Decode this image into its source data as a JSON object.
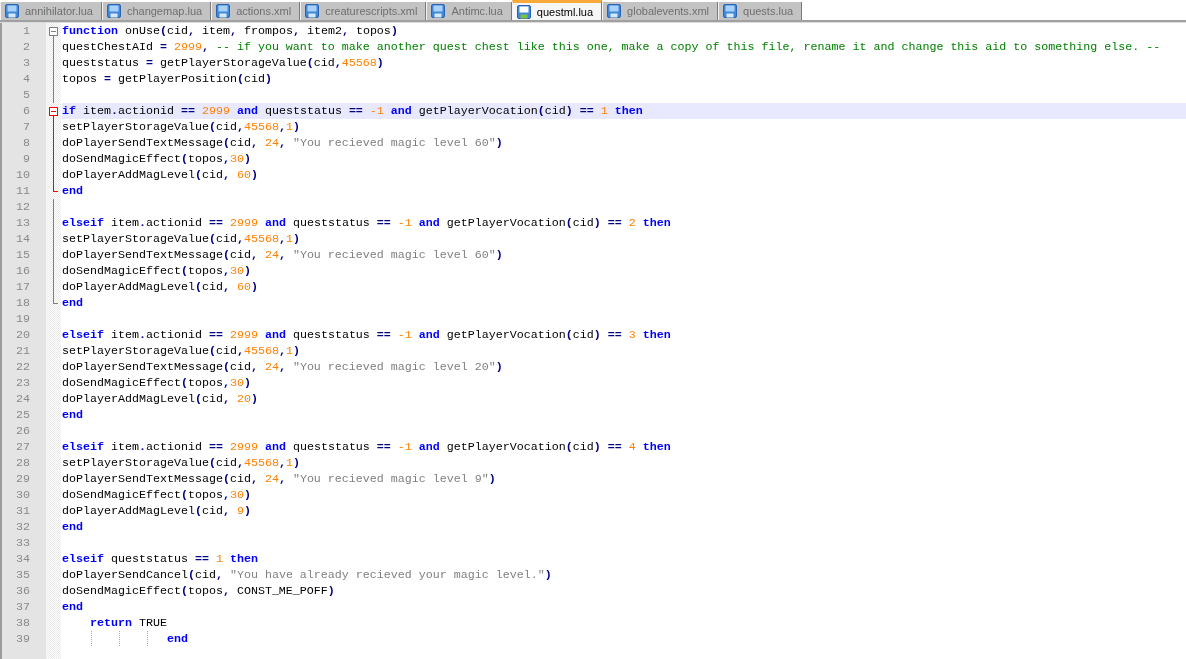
{
  "tabs": [
    {
      "label": "annihilator.lua",
      "selected": false
    },
    {
      "label": "changemap.lua",
      "selected": false
    },
    {
      "label": "actions.xml",
      "selected": false
    },
    {
      "label": "creaturescripts.xml",
      "selected": false
    },
    {
      "label": "Antimc.lua",
      "selected": false
    },
    {
      "label": "questml.lua",
      "selected": true
    },
    {
      "label": "globalevents.xml",
      "selected": false
    },
    {
      "label": "quests.lua",
      "selected": false
    }
  ],
  "editor": {
    "lines": [
      {
        "number": "1",
        "current": false,
        "fold": {
          "kind": "head",
          "highlighted": false
        },
        "tokens": [
          {
            "kind": "keyword",
            "text": "function"
          },
          {
            "kind": "identifier",
            "text": " onUse"
          },
          {
            "kind": "operator",
            "text": "("
          },
          {
            "kind": "identifier",
            "text": "cid"
          },
          {
            "kind": "operator",
            "text": ","
          },
          {
            "kind": "identifier",
            "text": " item"
          },
          {
            "kind": "operator",
            "text": ","
          },
          {
            "kind": "identifier",
            "text": " frompos"
          },
          {
            "kind": "operator",
            "text": ","
          },
          {
            "kind": "identifier",
            "text": " item2"
          },
          {
            "kind": "operator",
            "text": ","
          },
          {
            "kind": "identifier",
            "text": " topos"
          },
          {
            "kind": "operator",
            "text": ")"
          }
        ]
      },
      {
        "number": "2",
        "current": false,
        "fold": {
          "kind": "body",
          "highlighted": false
        },
        "tokens": [
          {
            "kind": "identifier",
            "text": "questChestAId "
          },
          {
            "kind": "operator",
            "text": "="
          },
          {
            "kind": "number",
            "text": " 2999"
          },
          {
            "kind": "operator",
            "text": ","
          },
          {
            "kind": "comment",
            "text": " -- if you want to make another quest chest like this one, make a copy of this file, rename it and change this aid to something else. --"
          }
        ]
      },
      {
        "number": "3",
        "current": false,
        "fold": {
          "kind": "body",
          "highlighted": false
        },
        "tokens": [
          {
            "kind": "identifier",
            "text": "queststatus "
          },
          {
            "kind": "operator",
            "text": "="
          },
          {
            "kind": "identifier",
            "text": " getPlayerStorageValue"
          },
          {
            "kind": "operator",
            "text": "("
          },
          {
            "kind": "identifier",
            "text": "cid"
          },
          {
            "kind": "operator",
            "text": ","
          },
          {
            "kind": "number",
            "text": "45568"
          },
          {
            "kind": "operator",
            "text": ")"
          }
        ]
      },
      {
        "number": "4",
        "current": false,
        "fold": {
          "kind": "body",
          "highlighted": false
        },
        "tokens": [
          {
            "kind": "identifier",
            "text": "topos "
          },
          {
            "kind": "operator",
            "text": "="
          },
          {
            "kind": "identifier",
            "text": " getPlayerPosition"
          },
          {
            "kind": "operator",
            "text": "("
          },
          {
            "kind": "identifier",
            "text": "cid"
          },
          {
            "kind": "operator",
            "text": ")"
          }
        ]
      },
      {
        "number": "5",
        "current": false,
        "fold": {
          "kind": "body",
          "highlighted": false
        }
      },
      {
        "number": "6",
        "current": true,
        "fold": {
          "kind": "head",
          "highlighted": true
        },
        "tokens": [
          {
            "kind": "keyword",
            "text": "if"
          },
          {
            "kind": "identifier",
            "text": " item"
          },
          {
            "kind": "operator",
            "text": "."
          },
          {
            "kind": "identifier",
            "text": "actionid "
          },
          {
            "kind": "operator",
            "text": "=="
          },
          {
            "kind": "number",
            "text": " 2999 "
          },
          {
            "kind": "keyword",
            "text": "and"
          },
          {
            "kind": "identifier",
            "text": " queststatus "
          },
          {
            "kind": "operator",
            "text": "=="
          },
          {
            "kind": "number",
            "text": " -1 "
          },
          {
            "kind": "keyword",
            "text": "and"
          },
          {
            "kind": "identifier",
            "text": " getPlayerVocation"
          },
          {
            "kind": "operator",
            "text": "("
          },
          {
            "kind": "identifier",
            "text": "cid"
          },
          {
            "kind": "operator",
            "text": ")"
          },
          {
            "kind": "operator",
            "text": " == "
          },
          {
            "kind": "number",
            "text": "1 "
          },
          {
            "kind": "keyword",
            "text": "then"
          }
        ]
      },
      {
        "number": "7",
        "current": false,
        "fold": {
          "kind": "body",
          "highlighted": true
        },
        "tokens": [
          {
            "kind": "identifier",
            "text": "setPlayerStorageValue"
          },
          {
            "kind": "operator",
            "text": "("
          },
          {
            "kind": "identifier",
            "text": "cid"
          },
          {
            "kind": "operator",
            "text": ","
          },
          {
            "kind": "number",
            "text": "45568"
          },
          {
            "kind": "operator",
            "text": ","
          },
          {
            "kind": "number",
            "text": "1"
          },
          {
            "kind": "operator",
            "text": ")"
          }
        ]
      },
      {
        "number": "8",
        "current": false,
        "fold": {
          "kind": "body",
          "highlighted": true
        },
        "tokens": [
          {
            "kind": "identifier",
            "text": "doPlayerSendTextMessage"
          },
          {
            "kind": "operator",
            "text": "("
          },
          {
            "kind": "identifier",
            "text": "cid"
          },
          {
            "kind": "operator",
            "text": ","
          },
          {
            "kind": "number",
            "text": " 24"
          },
          {
            "kind": "operator",
            "text": ","
          },
          {
            "kind": "string",
            "text": " \"You recieved magic level 60\""
          },
          {
            "kind": "operator",
            "text": ")"
          }
        ]
      },
      {
        "number": "9",
        "current": false,
        "fold": {
          "kind": "body",
          "highlighted": true
        },
        "tokens": [
          {
            "kind": "identifier",
            "text": "doSendMagicEffect"
          },
          {
            "kind": "operator",
            "text": "("
          },
          {
            "kind": "identifier",
            "text": "topos"
          },
          {
            "kind": "operator",
            "text": ","
          },
          {
            "kind": "number",
            "text": "30"
          },
          {
            "kind": "operator",
            "text": ")"
          }
        ]
      },
      {
        "number": "10",
        "current": false,
        "fold": {
          "kind": "body",
          "highlighted": true
        },
        "tokens": [
          {
            "kind": "identifier",
            "text": "doPlayerAddMagLevel"
          },
          {
            "kind": "operator",
            "text": "("
          },
          {
            "kind": "identifier",
            "text": "cid"
          },
          {
            "kind": "operator",
            "text": ","
          },
          {
            "kind": "number",
            "text": " 60"
          },
          {
            "kind": "operator",
            "text": ")"
          }
        ]
      },
      {
        "number": "11",
        "current": false,
        "fold": {
          "kind": "tail",
          "highlighted": true
        },
        "tokens": [
          {
            "kind": "keyword",
            "text": "end"
          }
        ]
      },
      {
        "number": "12",
        "current": false,
        "fold": {
          "kind": "body",
          "highlighted": false
        }
      },
      {
        "number": "13",
        "current": false,
        "fold": {
          "kind": "body",
          "highlighted": false
        },
        "tokens": [
          {
            "kind": "keyword",
            "text": "elseif"
          },
          {
            "kind": "identifier",
            "text": " item"
          },
          {
            "kind": "operator",
            "text": "."
          },
          {
            "kind": "identifier",
            "text": "actionid "
          },
          {
            "kind": "operator",
            "text": "=="
          },
          {
            "kind": "number",
            "text": " 2999 "
          },
          {
            "kind": "keyword",
            "text": "and"
          },
          {
            "kind": "identifier",
            "text": " queststatus "
          },
          {
            "kind": "operator",
            "text": "=="
          },
          {
            "kind": "number",
            "text": " -1 "
          },
          {
            "kind": "keyword",
            "text": "and"
          },
          {
            "kind": "identifier",
            "text": " getPlayerVocation"
          },
          {
            "kind": "operator",
            "text": "("
          },
          {
            "kind": "identifier",
            "text": "cid"
          },
          {
            "kind": "operator",
            "text": ")"
          },
          {
            "kind": "operator",
            "text": " == "
          },
          {
            "kind": "number",
            "text": "2 "
          },
          {
            "kind": "keyword",
            "text": "then"
          }
        ]
      },
      {
        "number": "14",
        "current": false,
        "fold": {
          "kind": "body",
          "highlighted": false
        },
        "tokens": [
          {
            "kind": "identifier",
            "text": "setPlayerStorageValue"
          },
          {
            "kind": "operator",
            "text": "("
          },
          {
            "kind": "identifier",
            "text": "cid"
          },
          {
            "kind": "operator",
            "text": ","
          },
          {
            "kind": "number",
            "text": "45568"
          },
          {
            "kind": "operator",
            "text": ","
          },
          {
            "kind": "number",
            "text": "1"
          },
          {
            "kind": "operator",
            "text": ")"
          }
        ]
      },
      {
        "number": "15",
        "current": false,
        "fold": {
          "kind": "body",
          "highlighted": false
        },
        "tokens": [
          {
            "kind": "identifier",
            "text": "doPlayerSendTextMessage"
          },
          {
            "kind": "operator",
            "text": "("
          },
          {
            "kind": "identifier",
            "text": "cid"
          },
          {
            "kind": "operator",
            "text": ","
          },
          {
            "kind": "number",
            "text": " 24"
          },
          {
            "kind": "operator",
            "text": ","
          },
          {
            "kind": "string",
            "text": " \"You recieved magic level 60\""
          },
          {
            "kind": "operator",
            "text": ")"
          }
        ]
      },
      {
        "number": "16",
        "current": false,
        "fold": {
          "kind": "body",
          "highlighted": false
        },
        "tokens": [
          {
            "kind": "identifier",
            "text": "doSendMagicEffect"
          },
          {
            "kind": "operator",
            "text": "("
          },
          {
            "kind": "identifier",
            "text": "topos"
          },
          {
            "kind": "operator",
            "text": ","
          },
          {
            "kind": "number",
            "text": "30"
          },
          {
            "kind": "operator",
            "text": ")"
          }
        ]
      },
      {
        "number": "17",
        "current": false,
        "fold": {
          "kind": "body",
          "highlighted": false
        },
        "tokens": [
          {
            "kind": "identifier",
            "text": "doPlayerAddMagLevel"
          },
          {
            "kind": "operator",
            "text": "("
          },
          {
            "kind": "identifier",
            "text": "cid"
          },
          {
            "kind": "operator",
            "text": ","
          },
          {
            "kind": "number",
            "text": " 60"
          },
          {
            "kind": "operator",
            "text": ")"
          }
        ]
      },
      {
        "number": "18",
        "current": false,
        "fold": {
          "kind": "tail",
          "highlighted": false
        },
        "tokens": [
          {
            "kind": "keyword",
            "text": "end"
          }
        ]
      },
      {
        "number": "19",
        "current": false
      },
      {
        "number": "20",
        "current": false,
        "tokens": [
          {
            "kind": "keyword",
            "text": "elseif"
          },
          {
            "kind": "identifier",
            "text": " item"
          },
          {
            "kind": "operator",
            "text": "."
          },
          {
            "kind": "identifier",
            "text": "actionid "
          },
          {
            "kind": "operator",
            "text": "=="
          },
          {
            "kind": "number",
            "text": " 2999 "
          },
          {
            "kind": "keyword",
            "text": "and"
          },
          {
            "kind": "identifier",
            "text": " queststatus "
          },
          {
            "kind": "operator",
            "text": "=="
          },
          {
            "kind": "number",
            "text": " -1 "
          },
          {
            "kind": "keyword",
            "text": "and"
          },
          {
            "kind": "identifier",
            "text": " getPlayerVocation"
          },
          {
            "kind": "operator",
            "text": "("
          },
          {
            "kind": "identifier",
            "text": "cid"
          },
          {
            "kind": "operator",
            "text": ")"
          },
          {
            "kind": "operator",
            "text": " == "
          },
          {
            "kind": "number",
            "text": "3 "
          },
          {
            "kind": "keyword",
            "text": "then"
          }
        ]
      },
      {
        "number": "21",
        "current": false,
        "tokens": [
          {
            "kind": "identifier",
            "text": "setPlayerStorageValue"
          },
          {
            "kind": "operator",
            "text": "("
          },
          {
            "kind": "identifier",
            "text": "cid"
          },
          {
            "kind": "operator",
            "text": ","
          },
          {
            "kind": "number",
            "text": "45568"
          },
          {
            "kind": "operator",
            "text": ","
          },
          {
            "kind": "number",
            "text": "1"
          },
          {
            "kind": "operator",
            "text": ")"
          }
        ]
      },
      {
        "number": "22",
        "current": false,
        "tokens": [
          {
            "kind": "identifier",
            "text": "doPlayerSendTextMessage"
          },
          {
            "kind": "operator",
            "text": "("
          },
          {
            "kind": "identifier",
            "text": "cid"
          },
          {
            "kind": "operator",
            "text": ","
          },
          {
            "kind": "number",
            "text": " 24"
          },
          {
            "kind": "operator",
            "text": ","
          },
          {
            "kind": "string",
            "text": " \"You recieved magic level 20\""
          },
          {
            "kind": "operator",
            "text": ")"
          }
        ]
      },
      {
        "number": "23",
        "current": false,
        "tokens": [
          {
            "kind": "identifier",
            "text": "doSendMagicEffect"
          },
          {
            "kind": "operator",
            "text": "("
          },
          {
            "kind": "identifier",
            "text": "topos"
          },
          {
            "kind": "operator",
            "text": ","
          },
          {
            "kind": "number",
            "text": "30"
          },
          {
            "kind": "operator",
            "text": ")"
          }
        ]
      },
      {
        "number": "24",
        "current": false,
        "tokens": [
          {
            "kind": "identifier",
            "text": "doPlayerAddMagLevel"
          },
          {
            "kind": "operator",
            "text": "("
          },
          {
            "kind": "identifier",
            "text": "cid"
          },
          {
            "kind": "operator",
            "text": ","
          },
          {
            "kind": "number",
            "text": " 20"
          },
          {
            "kind": "operator",
            "text": ")"
          }
        ]
      },
      {
        "number": "25",
        "current": false,
        "tokens": [
          {
            "kind": "keyword",
            "text": "end"
          }
        ]
      },
      {
        "number": "26",
        "current": false
      },
      {
        "number": "27",
        "current": false,
        "tokens": [
          {
            "kind": "keyword",
            "text": "elseif"
          },
          {
            "kind": "identifier",
            "text": " item"
          },
          {
            "kind": "operator",
            "text": "."
          },
          {
            "kind": "identifier",
            "text": "actionid "
          },
          {
            "kind": "operator",
            "text": "=="
          },
          {
            "kind": "number",
            "text": " 2999 "
          },
          {
            "kind": "keyword",
            "text": "and"
          },
          {
            "kind": "identifier",
            "text": " queststatus "
          },
          {
            "kind": "operator",
            "text": "=="
          },
          {
            "kind": "number",
            "text": " -1 "
          },
          {
            "kind": "keyword",
            "text": "and"
          },
          {
            "kind": "identifier",
            "text": " getPlayerVocation"
          },
          {
            "kind": "operator",
            "text": "("
          },
          {
            "kind": "identifier",
            "text": "cid"
          },
          {
            "kind": "operator",
            "text": ")"
          },
          {
            "kind": "operator",
            "text": " == "
          },
          {
            "kind": "number",
            "text": "4 "
          },
          {
            "kind": "keyword",
            "text": "then"
          }
        ]
      },
      {
        "number": "28",
        "current": false,
        "tokens": [
          {
            "kind": "identifier",
            "text": "setPlayerStorageValue"
          },
          {
            "kind": "operator",
            "text": "("
          },
          {
            "kind": "identifier",
            "text": "cid"
          },
          {
            "kind": "operator",
            "text": ","
          },
          {
            "kind": "number",
            "text": "45568"
          },
          {
            "kind": "operator",
            "text": ","
          },
          {
            "kind": "number",
            "text": "1"
          },
          {
            "kind": "operator",
            "text": ")"
          }
        ]
      },
      {
        "number": "29",
        "current": false,
        "tokens": [
          {
            "kind": "identifier",
            "text": "doPlayerSendTextMessage"
          },
          {
            "kind": "operator",
            "text": "("
          },
          {
            "kind": "identifier",
            "text": "cid"
          },
          {
            "kind": "operator",
            "text": ","
          },
          {
            "kind": "number",
            "text": " 24"
          },
          {
            "kind": "operator",
            "text": ","
          },
          {
            "kind": "string",
            "text": " \"You recieved magic level 9\""
          },
          {
            "kind": "operator",
            "text": ")"
          }
        ]
      },
      {
        "number": "30",
        "current": false,
        "tokens": [
          {
            "kind": "identifier",
            "text": "doSendMagicEffect"
          },
          {
            "kind": "operator",
            "text": "("
          },
          {
            "kind": "identifier",
            "text": "topos"
          },
          {
            "kind": "operator",
            "text": ","
          },
          {
            "kind": "number",
            "text": "30"
          },
          {
            "kind": "operator",
            "text": ")"
          }
        ]
      },
      {
        "number": "31",
        "current": false,
        "tokens": [
          {
            "kind": "identifier",
            "text": "doPlayerAddMagLevel"
          },
          {
            "kind": "operator",
            "text": "("
          },
          {
            "kind": "identifier",
            "text": "cid"
          },
          {
            "kind": "operator",
            "text": ","
          },
          {
            "kind": "number",
            "text": " 9"
          },
          {
            "kind": "operator",
            "text": ")"
          }
        ]
      },
      {
        "number": "32",
        "current": false,
        "tokens": [
          {
            "kind": "keyword",
            "text": "end"
          }
        ]
      },
      {
        "number": "33",
        "current": false
      },
      {
        "number": "34",
        "current": false,
        "tokens": [
          {
            "kind": "keyword",
            "text": "elseif"
          },
          {
            "kind": "identifier",
            "text": " queststatus "
          },
          {
            "kind": "operator",
            "text": "=="
          },
          {
            "kind": "number",
            "text": " 1 "
          },
          {
            "kind": "keyword",
            "text": "then"
          }
        ]
      },
      {
        "number": "35",
        "current": false,
        "tokens": [
          {
            "kind": "identifier",
            "text": "doPlayerSendCancel"
          },
          {
            "kind": "operator",
            "text": "("
          },
          {
            "kind": "identifier",
            "text": "cid"
          },
          {
            "kind": "operator",
            "text": ","
          },
          {
            "kind": "string",
            "text": " \"You have already recieved your magic level.\""
          },
          {
            "kind": "operator",
            "text": ")"
          }
        ]
      },
      {
        "number": "36",
        "current": false,
        "tokens": [
          {
            "kind": "identifier",
            "text": "doSendMagicEffect"
          },
          {
            "kind": "operator",
            "text": "("
          },
          {
            "kind": "identifier",
            "text": "topos"
          },
          {
            "kind": "operator",
            "text": ","
          },
          {
            "kind": "identifier",
            "text": " CONST_ME_POFF"
          },
          {
            "kind": "operator",
            "text": ")"
          }
        ]
      },
      {
        "number": "37",
        "current": false,
        "tokens": [
          {
            "kind": "keyword",
            "text": "end"
          }
        ]
      },
      {
        "number": "38",
        "current": false,
        "tokens": [
          {
            "kind": "keyword",
            "text": "    return"
          },
          {
            "kind": "identifier",
            "text": " TRUE"
          }
        ]
      },
      {
        "number": "39",
        "current": false,
        "tokens": [
          {
            "kind": "keyword",
            "text": "               end"
          }
        ]
      }
    ]
  }
}
